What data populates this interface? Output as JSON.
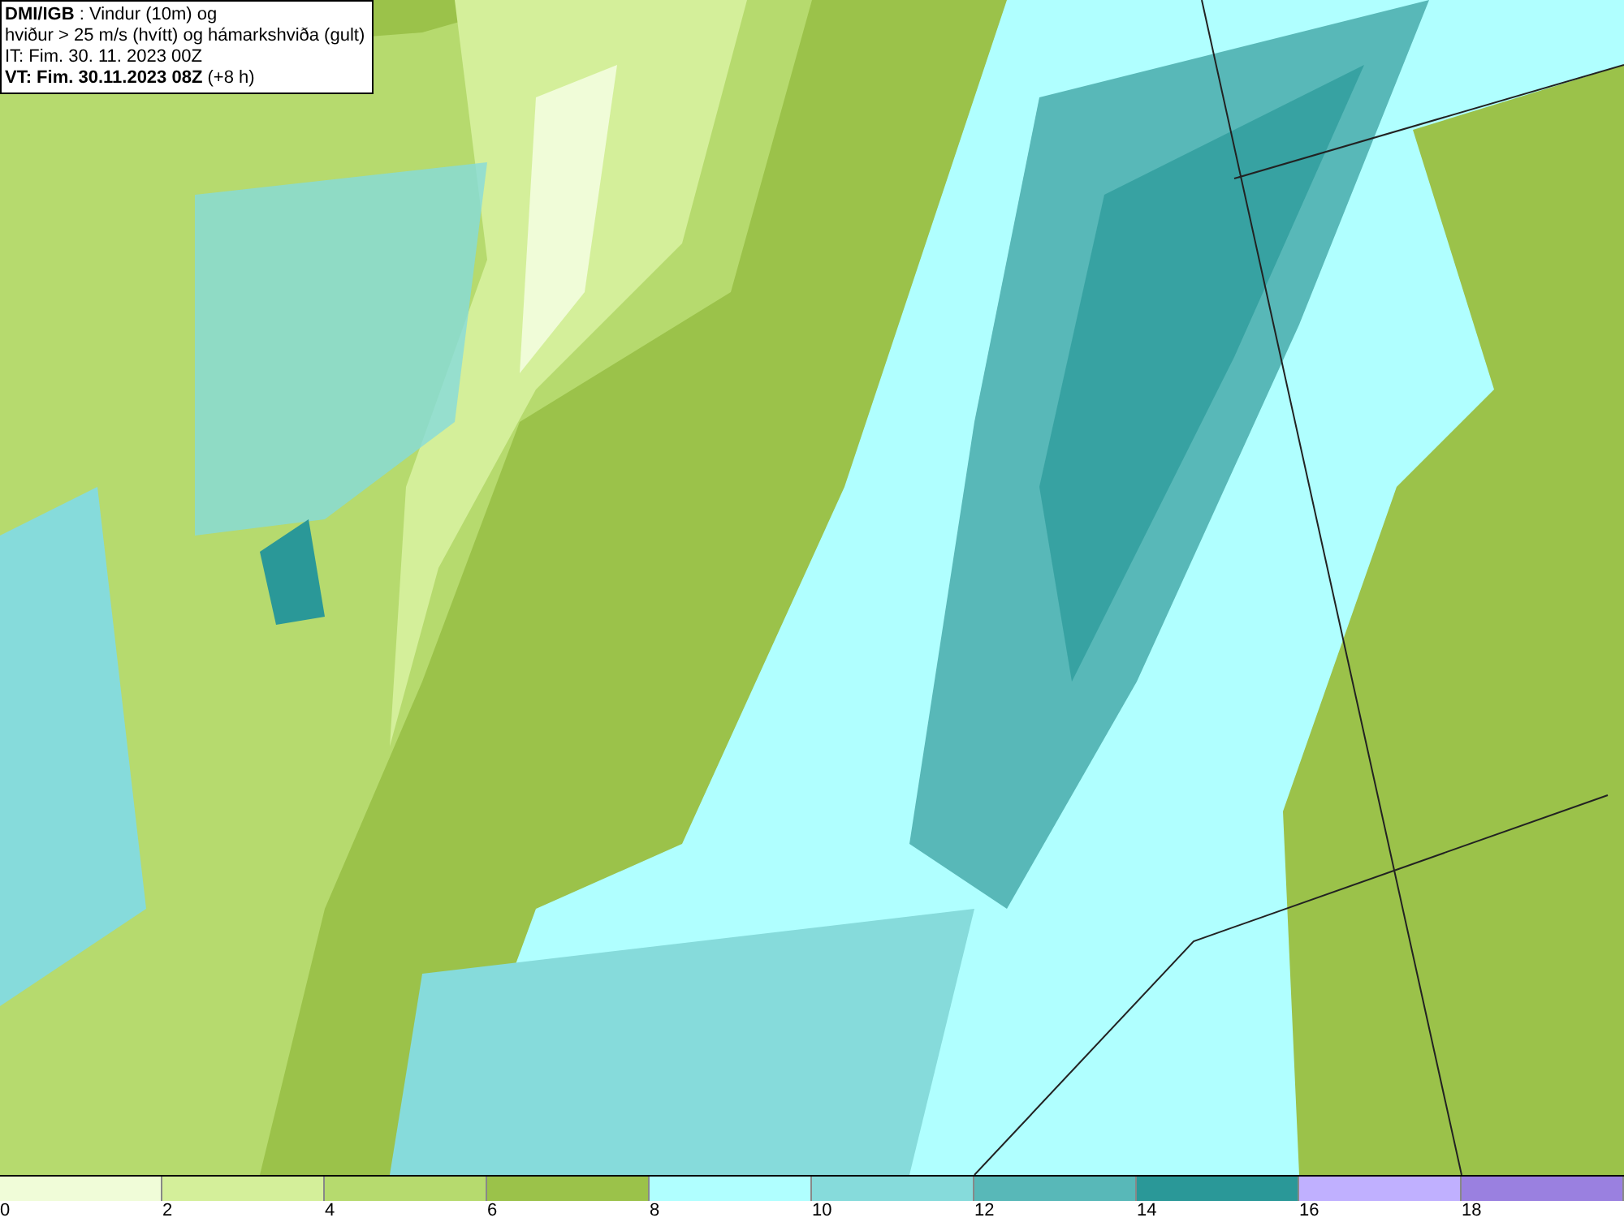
{
  "header": {
    "lines": [
      "**DMI/IGB** : Vindur (10m) og",
      "hviður > 25 m/s (hvítt) og hámarkshviða (gult)",
      "IT: Fim. 30. 11. 2023 00Z",
      "**VT: Fim. 30.11.2023 08Z** (+8 h)"
    ]
  },
  "legend": {
    "items": [
      {
        "label": "0",
        "color": "#f0fcd8"
      },
      {
        "label": "2",
        "color": "#d4ef9a"
      },
      {
        "label": "4",
        "color": "#b6da6e"
      },
      {
        "label": "6",
        "color": "#9bc24a"
      },
      {
        "label": "8",
        "color": "#b0ffff"
      },
      {
        "label": "10",
        "color": "#86dbdb"
      },
      {
        "label": "12",
        "color": "#58b8b8"
      },
      {
        "label": "14",
        "color": "#2a9898"
      },
      {
        "label": "16",
        "color": "#c0b0ff"
      },
      {
        "label": "18",
        "color": "#9a80e0"
      }
    ]
  }
}
